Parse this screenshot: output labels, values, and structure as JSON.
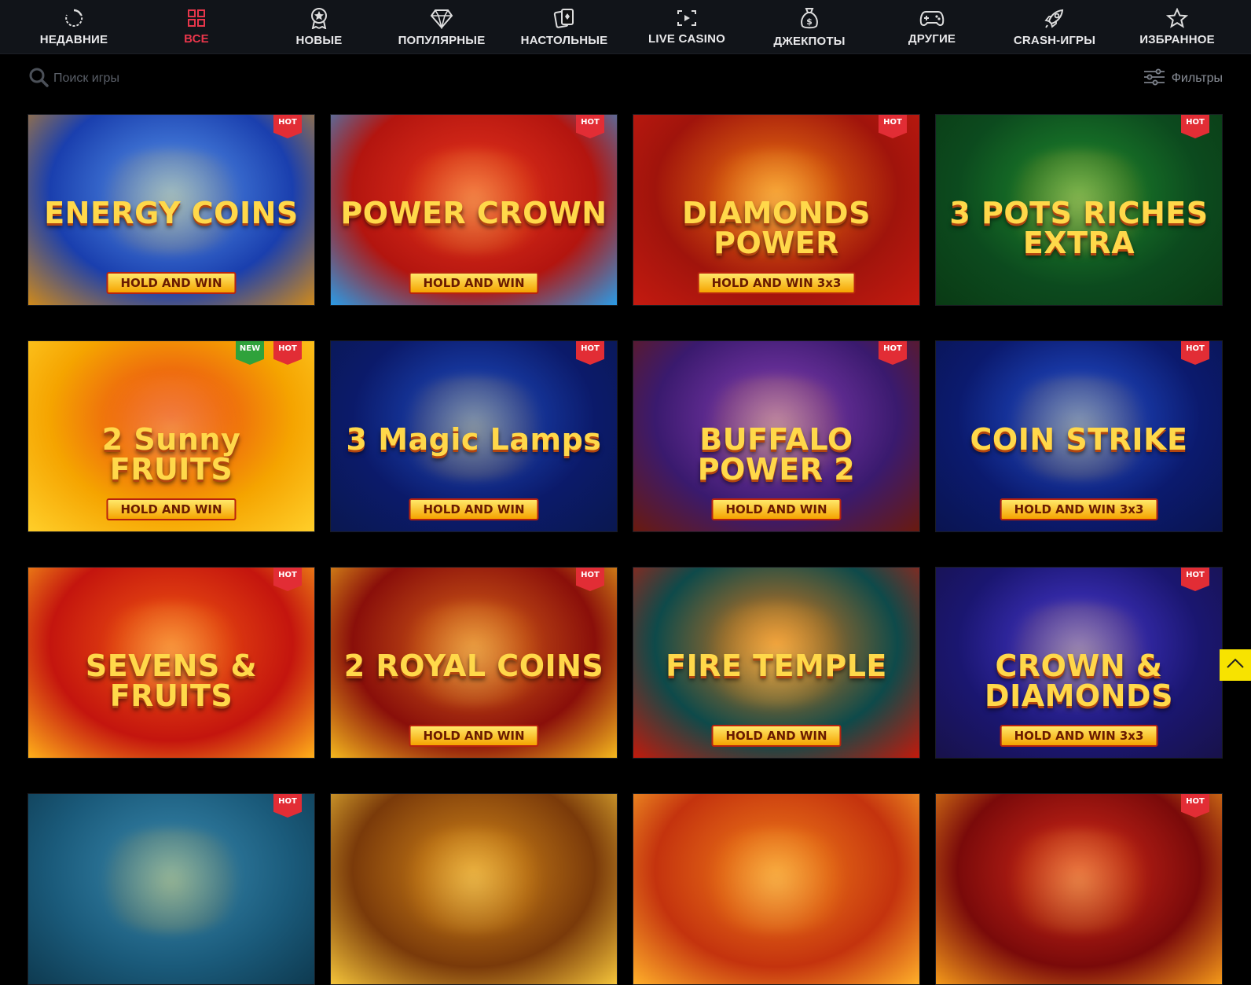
{
  "nav": {
    "items": [
      {
        "label": "НЕДАВНИЕ",
        "icon": "recent-icon",
        "active": false
      },
      {
        "label": "ВСЕ",
        "icon": "grid-icon",
        "active": true
      },
      {
        "label": "НОВЫЕ",
        "icon": "new-badge-icon",
        "active": false
      },
      {
        "label": "ПОПУЛЯРНЫЕ",
        "icon": "diamond-icon",
        "active": false
      },
      {
        "label": "НАСТОЛЬНЫЕ",
        "icon": "cards-icon",
        "active": false
      },
      {
        "label": "LIVE CASINO",
        "icon": "live-video-icon",
        "active": false
      },
      {
        "label": "ДЖЕКПОТЫ",
        "icon": "money-bag-icon",
        "active": false
      },
      {
        "label": "ДРУГИЕ",
        "icon": "gamepad-icon",
        "active": false
      },
      {
        "label": "CRASH-ИГРЫ",
        "icon": "rocket-icon",
        "active": false
      },
      {
        "label": "ИЗБРАННОЕ",
        "icon": "star-icon",
        "active": false
      }
    ],
    "active_color": "#e8364b"
  },
  "search": {
    "placeholder": "Поиск игры",
    "icon": "search-icon"
  },
  "filters": {
    "label": "Фильтры",
    "icon": "sliders-icon"
  },
  "games": [
    {
      "title": "ENERGY COINS",
      "subtitle": "HOLD AND WIN",
      "badges": [
        "HOT"
      ],
      "bg": [
        "#1a3fae",
        "#5a9af0",
        "#d08a1a"
      ]
    },
    {
      "title": "POWER CROWN",
      "subtitle": "HOLD AND WIN",
      "badges": [
        "HOT"
      ],
      "bg": [
        "#b3150f",
        "#e8341e",
        "#2a9be6"
      ]
    },
    {
      "title": "DIAMONDS POWER",
      "subtitle": "HOLD AND WIN 3x3",
      "badges": [
        "HOT"
      ],
      "bg": [
        "#a0140c",
        "#f07a10",
        "#c41a10"
      ]
    },
    {
      "title": "3 POTS RICHES EXTRA",
      "subtitle": "",
      "badges": [
        "HOT"
      ],
      "bg": [
        "#0c4a1e",
        "#1f8d2e",
        "#0a3a14"
      ]
    },
    {
      "title": "2 Sunny FRUITS",
      "subtitle": "HOLD AND WIN",
      "badges": [
        "NEW",
        "HOT"
      ],
      "bg": [
        "#f5a400",
        "#e8381a",
        "#ffcf2a"
      ]
    },
    {
      "title": "3 Magic Lamps",
      "subtitle": "HOLD AND WIN",
      "badges": [
        "HOT"
      ],
      "bg": [
        "#0b1a6a",
        "#1f4fc8",
        "#0a1850"
      ]
    },
    {
      "title": "BUFFALO POWER 2",
      "subtitle": "HOLD AND WIN",
      "badges": [
        "HOT"
      ],
      "bg": [
        "#3a1a6e",
        "#8a3fb8",
        "#6a1a0e"
      ]
    },
    {
      "title": "COIN STRIKE",
      "subtitle": "HOLD AND WIN 3x3",
      "badges": [
        "HOT"
      ],
      "bg": [
        "#0b1a6e",
        "#2454d8",
        "#0a1450"
      ]
    },
    {
      "title": "SEVENS & FRUITS",
      "subtitle": "",
      "badges": [
        "HOT"
      ],
      "bg": [
        "#c4150e",
        "#f25a12",
        "#ffb01a"
      ]
    },
    {
      "title": "2 ROYAL COINS",
      "subtitle": "HOLD AND WIN",
      "badges": [
        "HOT"
      ],
      "bg": [
        "#8a0f0a",
        "#d8661a",
        "#f4b81e"
      ]
    },
    {
      "title": "FIRE TEMPLE",
      "subtitle": "HOLD AND WIN",
      "badges": [],
      "bg": [
        "#0e4a4a",
        "#e67a1a",
        "#c21a0c"
      ]
    },
    {
      "title": "CROWN & DIAMONDS",
      "subtitle": "HOLD AND WIN 3x3",
      "badges": [
        "HOT"
      ],
      "bg": [
        "#1a1670",
        "#4a3ad8",
        "#18124a"
      ]
    },
    {
      "title": "",
      "subtitle": "",
      "badges": [
        "HOT"
      ],
      "bg": [
        "#1a5a7a",
        "#3a8ab0",
        "#0e3a50"
      ]
    },
    {
      "title": "",
      "subtitle": "",
      "badges": [],
      "bg": [
        "#7a3a0a",
        "#d88a1a",
        "#f4c43a"
      ]
    },
    {
      "title": "",
      "subtitle": "",
      "badges": [],
      "bg": [
        "#c4330e",
        "#f2801a",
        "#ffb02a"
      ]
    },
    {
      "title": "",
      "subtitle": "",
      "badges": [
        "HOT"
      ],
      "bg": [
        "#7a0a0a",
        "#d82a1a",
        "#f49a1a"
      ]
    }
  ],
  "scroll_top": {
    "icon": "chevron-up-icon",
    "color": "#f7e300"
  }
}
